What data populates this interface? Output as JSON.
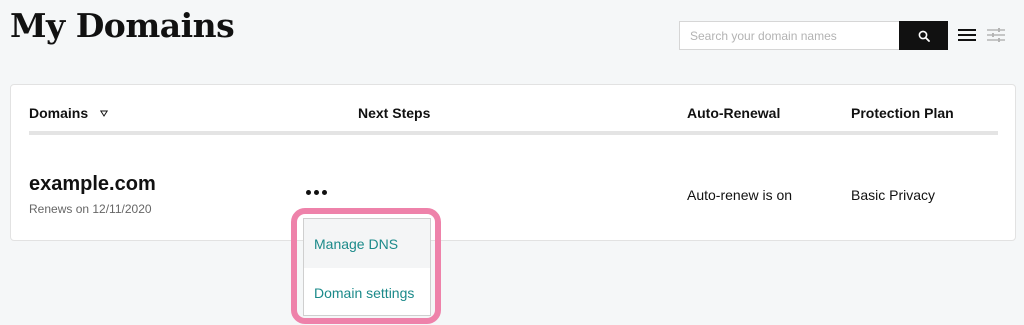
{
  "header": {
    "title": "My Domains",
    "search": {
      "placeholder": "Search your domain names",
      "value": ""
    },
    "search_icon": "search-icon",
    "view_icon": "hamburger-list-icon",
    "filter_icon": "sliders-filter-icon"
  },
  "table": {
    "columns": {
      "domains": "Domains",
      "next_steps": "Next Steps",
      "auto_renewal": "Auto-Renewal",
      "protection_plan": "Protection Plan"
    },
    "sort_icon": "triangle-down-icon",
    "rows": [
      {
        "domain": "example.com",
        "renews": "Renews on 12/11/2020",
        "auto_renewal": "Auto-renew is on",
        "protection_plan": "Basic Privacy",
        "more_icon": "ellipsis-icon"
      }
    ]
  },
  "menu": {
    "items": [
      {
        "label": "Manage DNS"
      },
      {
        "label": "Domain settings"
      }
    ],
    "highlight_color": "#ee82aa"
  },
  "colors": {
    "link": "#1b8a8a",
    "primary_button": "#111111",
    "background": "#f5f7f8"
  }
}
